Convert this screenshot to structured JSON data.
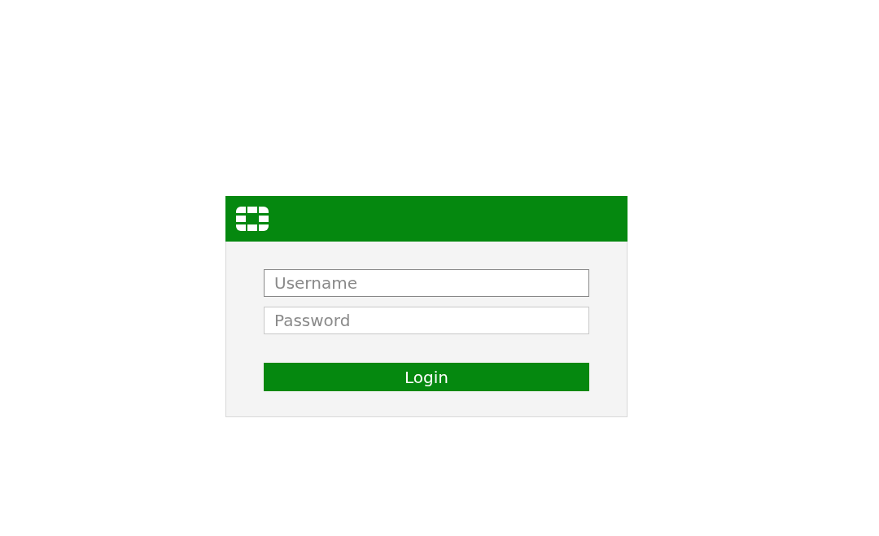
{
  "fields": [
    {
      "placeholder": "Username",
      "focused": true
    },
    {
      "placeholder": "Password",
      "focused": false
    }
  ],
  "login_button": {
    "label": "Login"
  }
}
